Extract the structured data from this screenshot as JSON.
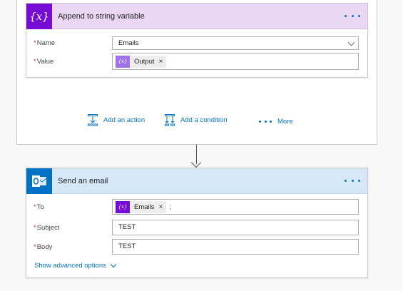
{
  "append_card": {
    "title": "Append to string variable",
    "name_label": "Name",
    "name_value": "Emails",
    "value_label": "Value",
    "value_token": "Output",
    "token_remove": "×"
  },
  "actions": {
    "add_action": "Add an action",
    "add_condition": "Add a condition",
    "more": "More"
  },
  "email_card": {
    "title": "Send an email",
    "to_label": "To",
    "to_token": "Emails",
    "to_suffix": ";",
    "token_remove": "×",
    "subject_label": "Subject",
    "subject_value": "TEST",
    "body_label": "Body",
    "body_value": "TEST",
    "advanced_options": "Show advanced options"
  },
  "required_marker": "*",
  "icons": {
    "variable": "variable-icon",
    "outlook": "outlook-icon",
    "add_action": "add-action-icon",
    "add_condition": "add-condition-icon",
    "more": "ellipsis-icon"
  },
  "colors": {
    "accent": "#0072c6",
    "variable_purple": "#770bd6",
    "append_header_bg": "#ead7f5",
    "email_header_bg": "#d6e8f7",
    "required": "#d13438"
  }
}
